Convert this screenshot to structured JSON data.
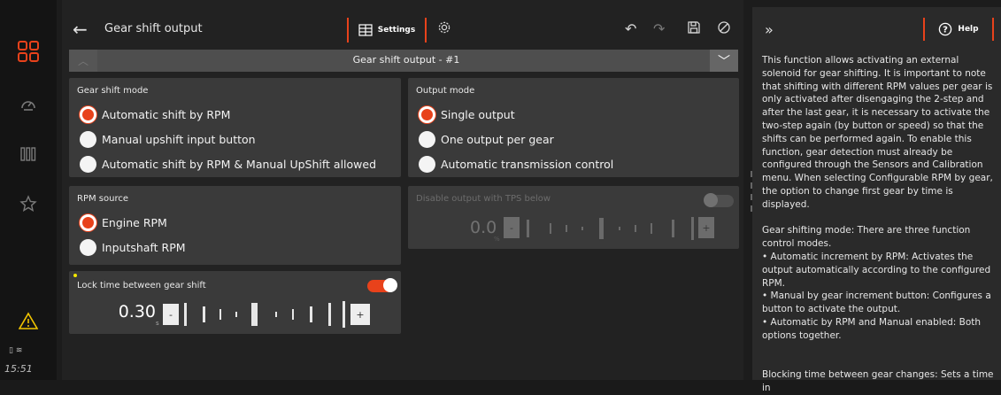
{
  "status": {
    "time": "15:51",
    "warning_icon": "warning-icon"
  },
  "rail": {
    "icons": [
      "home-grid-icon",
      "dashboard-gauge-icon",
      "columns-icon",
      "star-icon"
    ]
  },
  "header": {
    "title": "Gear shift output",
    "settings_label": "Settings"
  },
  "selector": {
    "label": "Gear shift output - #1"
  },
  "gear_shift_mode": {
    "title": "Gear shift mode",
    "options": [
      {
        "label": "Automatic shift by RPM",
        "selected": true
      },
      {
        "label": "Manual upshift input button",
        "selected": false
      },
      {
        "label": "Automatic shift by RPM & Manual UpShift allowed",
        "selected": false
      }
    ]
  },
  "output_mode": {
    "title": "Output mode",
    "options": [
      {
        "label": "Single output",
        "selected": true
      },
      {
        "label": "One output per gear",
        "selected": false
      },
      {
        "label": "Automatic transmission control",
        "selected": false
      }
    ]
  },
  "rpm_source": {
    "title": "RPM source",
    "options": [
      {
        "label": "Engine RPM",
        "selected": true
      },
      {
        "label": "Inputshaft RPM",
        "selected": false
      }
    ]
  },
  "tps": {
    "title": "Disable output with TPS below",
    "value": "0.0",
    "unit": "%",
    "enabled": false,
    "minus": "-",
    "plus": "+"
  },
  "lock_time": {
    "title": "Lock time between gear shift",
    "value": "0.30",
    "unit": "s",
    "enabled": true,
    "minus": "-",
    "plus": "+"
  },
  "help": {
    "button_label": "Help",
    "text": "This function allows activating an external solenoid for gear shifting. It is important to note that shifting with different RPM values per gear is only activated after disengaging the 2-step and after the last gear, it is necessary to activate the two-step again (by button or speed) so that the shifts can be performed again. To enable this function, gear detection must already be configured through the Sensors and Calibration menu. When selecting Configurable RPM by gear, the option to change first gear by time is displayed.\n\nGear shifting mode: There are three function control modes.\n• Automatic increment by RPM: Activates the output automatically according to the configured RPM.\n• Manual by gear increment button: Configures a button to activate the output.\n• Automatic by RPM and Manual enabled: Both options together.\n\n\nBlocking time between gear changes: Sets a time in"
  },
  "colors": {
    "accent": "#e8421b",
    "panel": "#3a3a3a",
    "background": "#222222"
  }
}
